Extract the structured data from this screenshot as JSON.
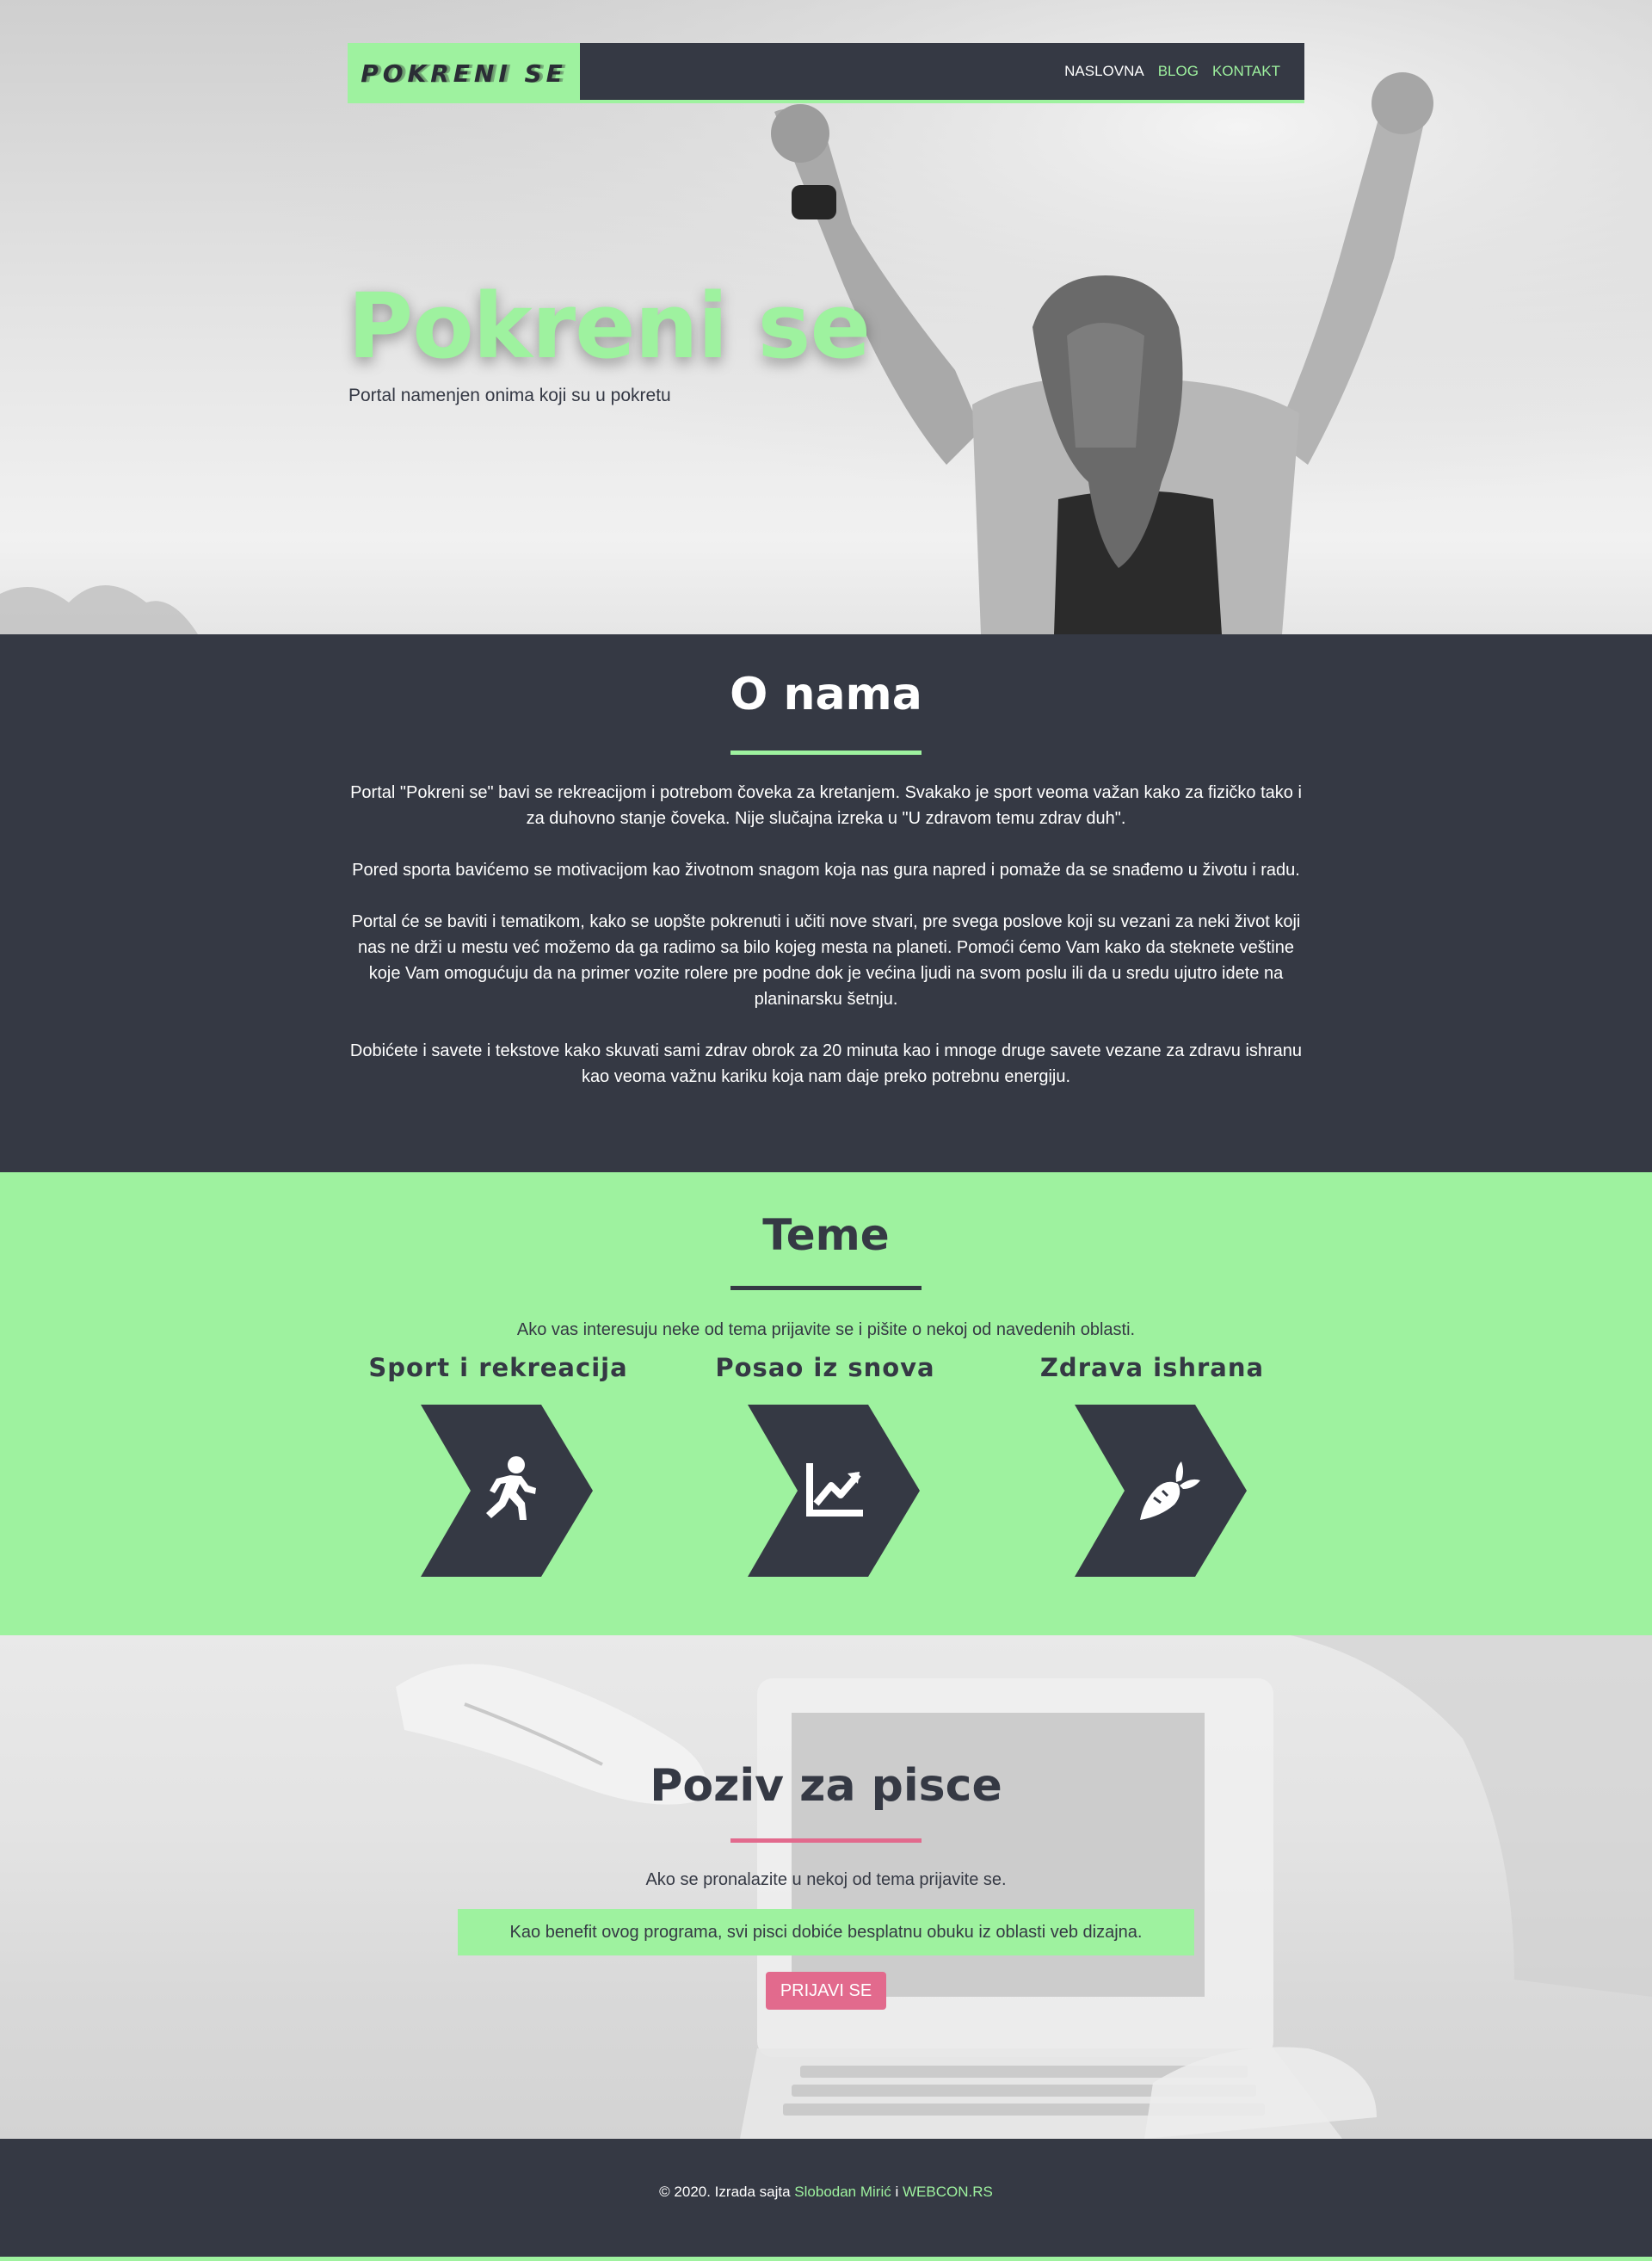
{
  "nav": {
    "logo": "POKRENI SE",
    "links": [
      "NASLOVNA",
      "BLOG",
      "KONTAKT"
    ]
  },
  "hero": {
    "title": "Pokreni se",
    "subtitle": "Portal namenjen onima koji su u pokretu"
  },
  "about": {
    "title": "O nama",
    "paragraphs": [
      "Portal \"Pokreni se\" bavi se rekreacijom i potrebom čoveka za kretanjem. Svakako je sport veoma važan kako za fizičko tako i za duhovno stanje čoveka. Nije slučajna izreka u \"U zdravom temu zdrav duh\".",
      "Pored sporta bavićemo se motivacijom kao životnom snagom koja nas gura napred i pomaže da se snađemo u životu i radu.",
      "Portal će se baviti i tematikom, kako se uopšte pokrenuti i učiti nove stvari, pre svega poslove koji su vezani za neki život koji nas ne drži u mestu već možemo da ga radimo sa bilo kojeg mesta na planeti. Pomoći ćemo Vam kako da steknete veštine koje Vam omogućuju da na primer vozite rolere pre podne dok je većina ljudi na svom poslu ili da u sredu ujutro idete na planinarsku šetnju.",
      "Dobićete i savete i tekstove kako skuvati sami zdrav obrok za 20 minuta kao i mnoge druge savete vezane za zdravu ishranu kao veoma važnu kariku koja nam daje preko potrebnu energiju."
    ]
  },
  "themes": {
    "title": "Teme",
    "intro": "Ako vas interesuju neke od tema prijavite se i pišite o nekoj od navedenih oblasti.",
    "items": [
      {
        "title": "Sport i rekreacija",
        "icon": "running-icon"
      },
      {
        "title": "Posao iz snova",
        "icon": "chart-line-icon"
      },
      {
        "title": "Zdrava ishrana",
        "icon": "carrot-icon"
      }
    ]
  },
  "call": {
    "title": "Poziv za pisce",
    "intro": "Ako se pronalazite u nekoj od tema prijavite se.",
    "benefit": "Kao benefit ovog programa, svi pisci dobiće besplatnu obuku iz oblasti veb dizajna.",
    "button": "PRIJAVI SE"
  },
  "footer": {
    "prefix": "© 2020. Izrada sajta ",
    "author": "Slobodan Mirić",
    "separator": " i ",
    "company": "WEBCON.RS"
  },
  "colors": {
    "dark": "#353944",
    "green": "#9ef29f",
    "pink": "#e26a8d",
    "white": "#ffffff"
  }
}
